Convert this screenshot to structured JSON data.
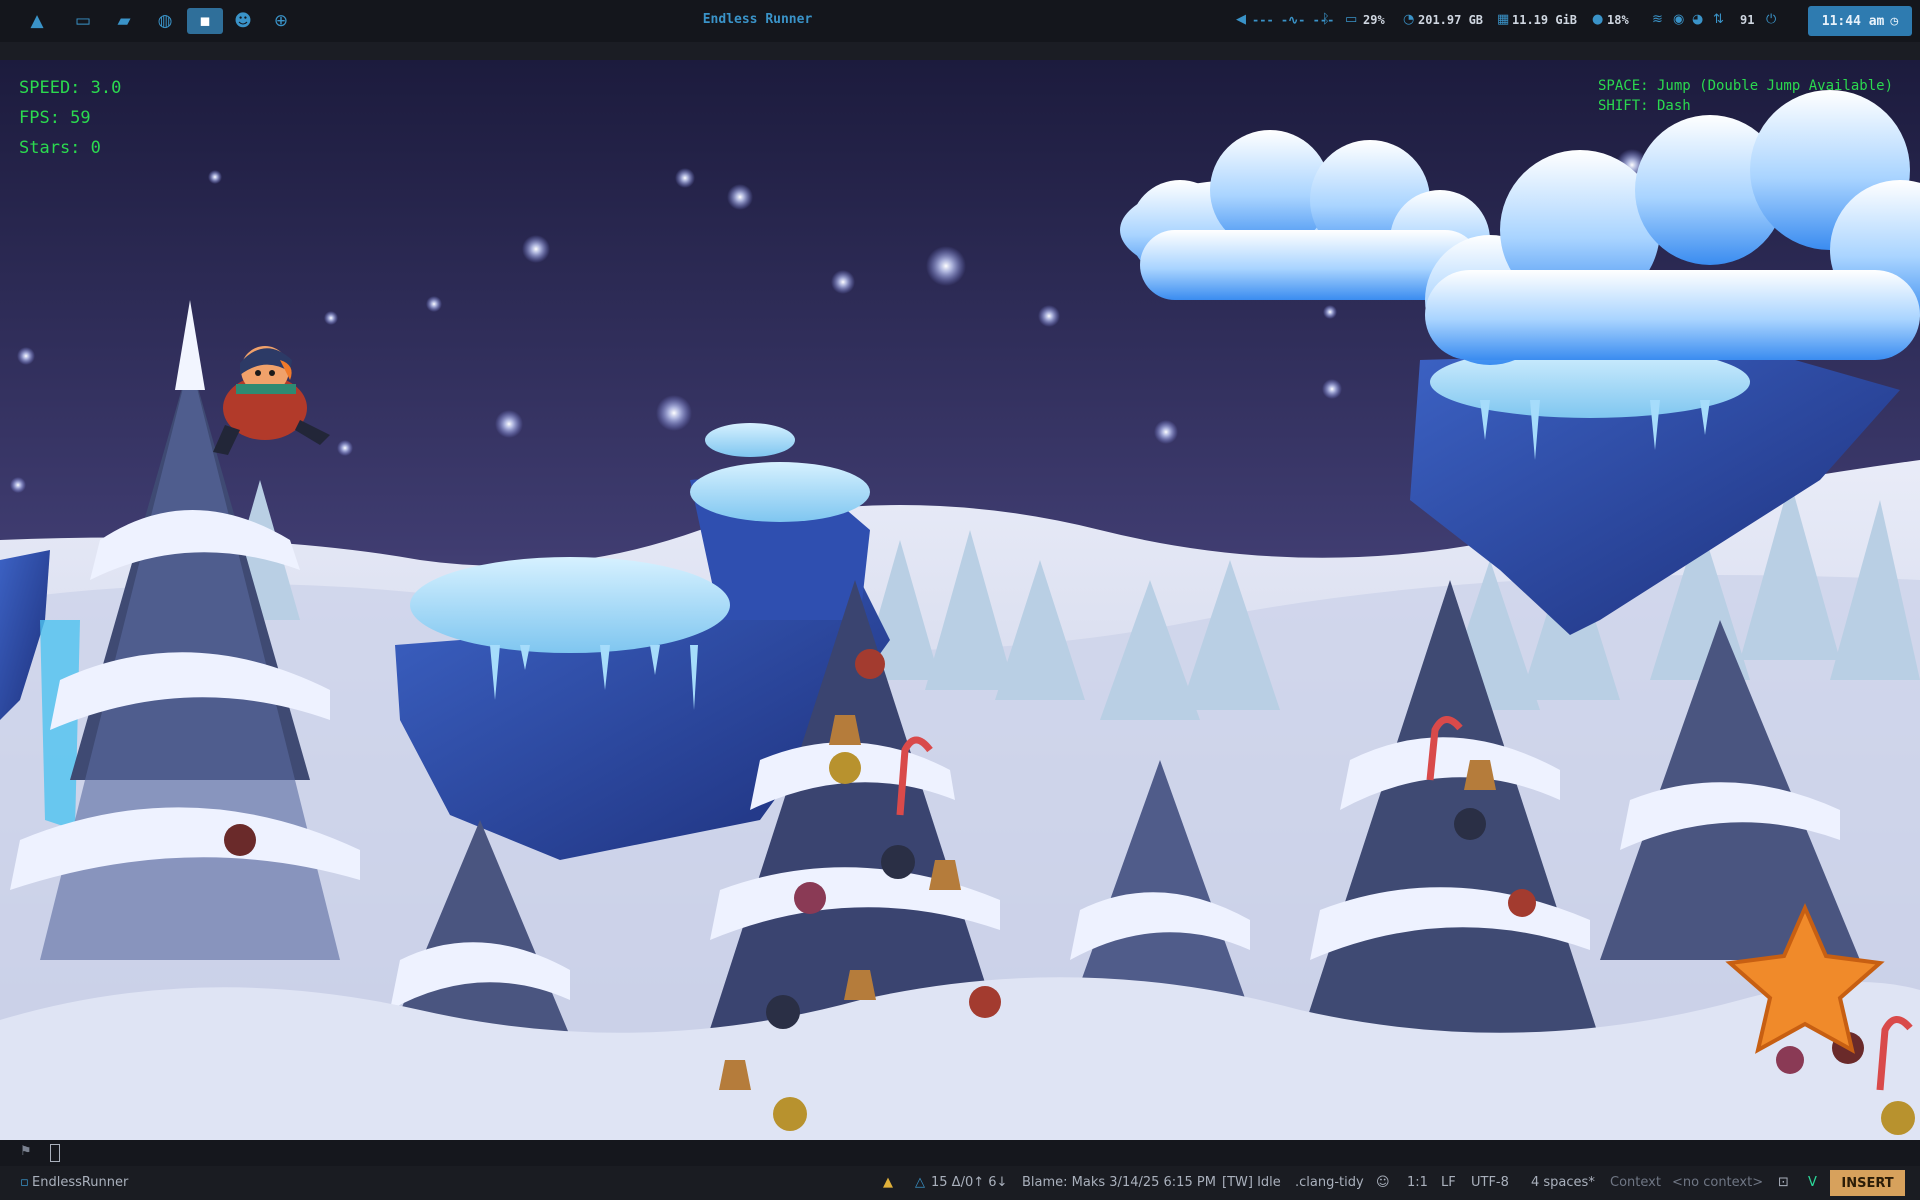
{
  "topbar": {
    "title": "Endless Runner",
    "icons": [
      "arch-logo-icon",
      "laptop-icon",
      "folder-icon",
      "globe-icon",
      "chat-icon",
      "alien-icon",
      "gamepad-icon"
    ],
    "audio": "--- -∿- ---",
    "battery": "29%",
    "disk": "201.97 GB",
    "memory": "11.19 GiB",
    "cpu": "18%",
    "updates": "91",
    "clock": "11:44 am"
  },
  "hud": {
    "speed": "SPEED: 3.0",
    "fps": "FPS: 59",
    "stars": "Stars: 0",
    "help_jump": "SPACE: Jump (Double Jump Available)",
    "help_dash": "SHIFT: Dash"
  },
  "statusbar": {
    "project": "EndlessRunner",
    "git": "15 Δ/0↑ 6↓",
    "blame": "Blame: Maks 3/14/25 6:15 PM",
    "tw": "[TW] Idle",
    "linter": ".clang-tidy",
    "position": "1:1",
    "line_ending": "LF",
    "encoding": "UTF-8",
    "indent": "4 spaces*",
    "context_label": "Context",
    "context_value": "<no context>",
    "mode": "INSERT"
  },
  "colors": {
    "accent": "#3a93c8",
    "hud_green": "#2bd94f",
    "mode_badge": "#d7a15c"
  }
}
